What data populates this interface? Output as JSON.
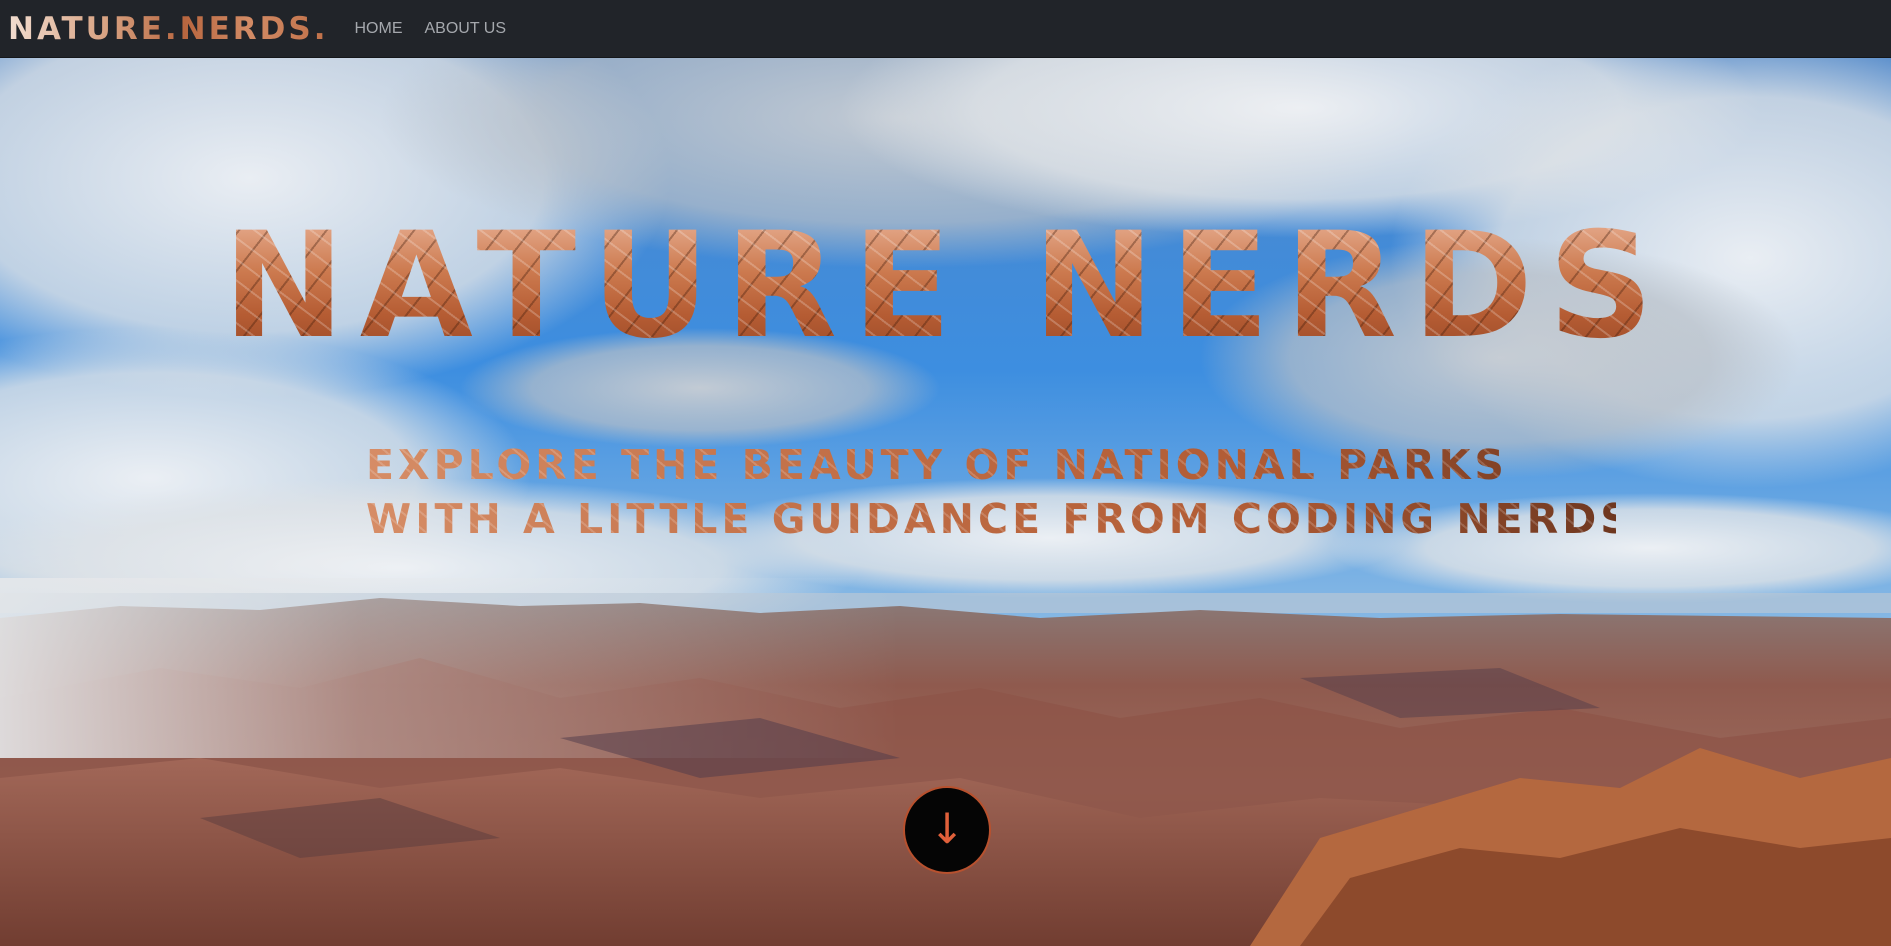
{
  "navbar": {
    "brand": "NATURE.NERDS.",
    "links": [
      {
        "label": "HOME"
      },
      {
        "label": "ABOUT US"
      }
    ]
  },
  "hero": {
    "title": "NATURE NERDS",
    "subtitle_lines": [
      "EXPLORE THE BEAUTY OF NATIONAL PARKS",
      "WITH A LITTLE GUIDANCE FROM CODING NERDS"
    ],
    "scroll_icon": "arrow-down-icon",
    "scroll_glyph": "↓"
  },
  "colors": {
    "navbar_bg": "#212429",
    "nav_link": "#a5a8ad",
    "accent": "#c06d45",
    "button_bg": "#050505",
    "button_border": "#b8512e"
  }
}
